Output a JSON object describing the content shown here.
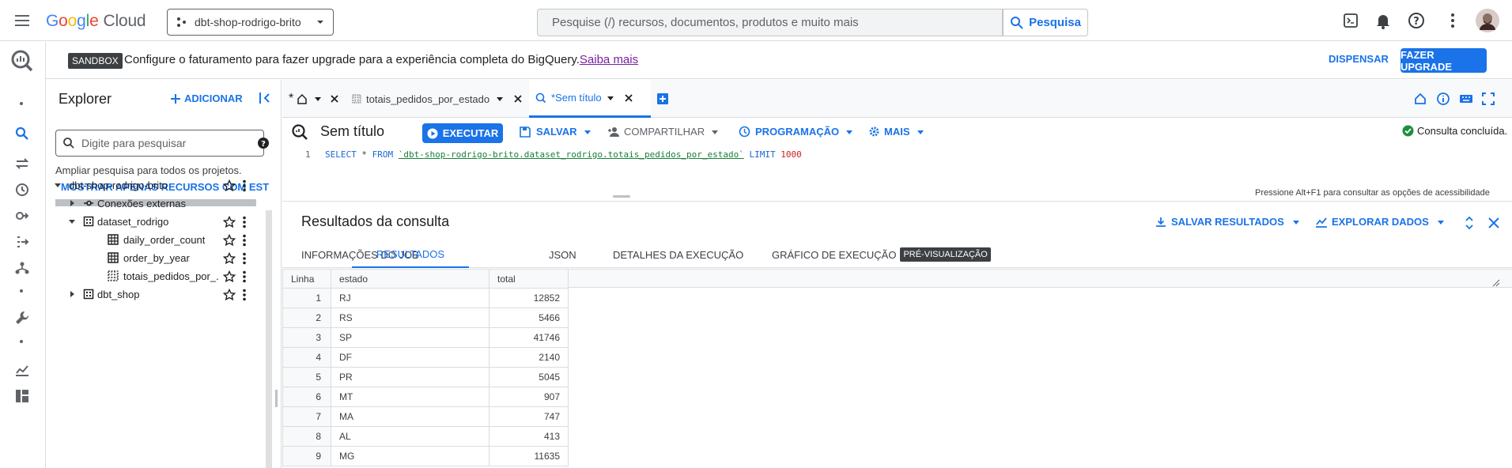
{
  "topbar": {
    "logo_letters": [
      "G",
      "o",
      "o",
      "g",
      "l",
      "e"
    ],
    "logo_suffix": "Cloud",
    "project": "dbt-shop-rodrigo-brito",
    "search_placeholder": "Pesquise (/) recursos, documentos, produtos e muito mais",
    "search_button": "Pesquisa"
  },
  "banner": {
    "chip": "SANDBOX",
    "text": "Configure o faturamento para fazer upgrade para a experiência completa do BigQuery.",
    "link": "Saiba mais",
    "dismiss": "DISPENSAR",
    "upgrade": "FAZER UPGRADE"
  },
  "explorer": {
    "title": "Explorer",
    "add_label": "ADICIONAR",
    "search_placeholder": "Digite para pesquisar",
    "broaden": "Ampliar pesquisa para todos os projetos.",
    "starred_link": "MOSTRAR APENAS RECURSOS COM ESTRELA",
    "tree": {
      "project": "dbt-shop-rodrigo-brito",
      "external": "Conexões externas",
      "dataset1": "dataset_rodrigo",
      "table1": "daily_order_count",
      "table2": "order_by_year",
      "table3": "totais_pedidos_por_...",
      "dataset2": "dbt_shop"
    }
  },
  "editor_tabs": {
    "tab1": "totais_pedidos_por_estado",
    "tab2": "*Sem título"
  },
  "toolbar": {
    "title": "Sem título",
    "run": "EXECUTAR",
    "save": "SALVAR",
    "share": "COMPARTILHAR",
    "schedule": "PROGRAMAÇÃO",
    "more": "MAIS",
    "status": "Consulta concluída."
  },
  "editor": {
    "line_number": "1",
    "kw_select": "SELECT",
    "star_from": " * ",
    "kw_from": "FROM",
    "table_ref": "`dbt-shop-rodrigo-brito.dataset_rodrigo.totais_pedidos_por_estado`",
    "kw_limit": "LIMIT",
    "limit_value": "1000",
    "a11y_hint": "Pressione Alt+F1 para consultar as opções de acessibilidade"
  },
  "results": {
    "title": "Resultados da consulta",
    "save_results": "SALVAR RESULTADOS",
    "explore_data": "EXPLORAR DADOS",
    "tabs": {
      "job_info": "INFORMAÇÕES DO JOB",
      "results": "RESULTADOS",
      "json": "JSON",
      "exec_details": "DETALHES DA EXECUÇÃO",
      "exec_graph": "GRÁFICO DE EXECUÇÃO",
      "preview_chip": "PRÉ-VISUALIZAÇÃO"
    },
    "columns": {
      "row": "Linha",
      "estado": "estado",
      "total": "total"
    },
    "rows": [
      {
        "n": "1",
        "estado": "RJ",
        "total": "12852"
      },
      {
        "n": "2",
        "estado": "RS",
        "total": "5466"
      },
      {
        "n": "3",
        "estado": "SP",
        "total": "41746"
      },
      {
        "n": "4",
        "estado": "DF",
        "total": "2140"
      },
      {
        "n": "5",
        "estado": "PR",
        "total": "5045"
      },
      {
        "n": "6",
        "estado": "MT",
        "total": "907"
      },
      {
        "n": "7",
        "estado": "MA",
        "total": "747"
      },
      {
        "n": "8",
        "estado": "AL",
        "total": "413"
      },
      {
        "n": "9",
        "estado": "MG",
        "total": "11635"
      }
    ]
  },
  "colors": {
    "accent": "#1a73e8",
    "success": "#1e8e3e"
  }
}
